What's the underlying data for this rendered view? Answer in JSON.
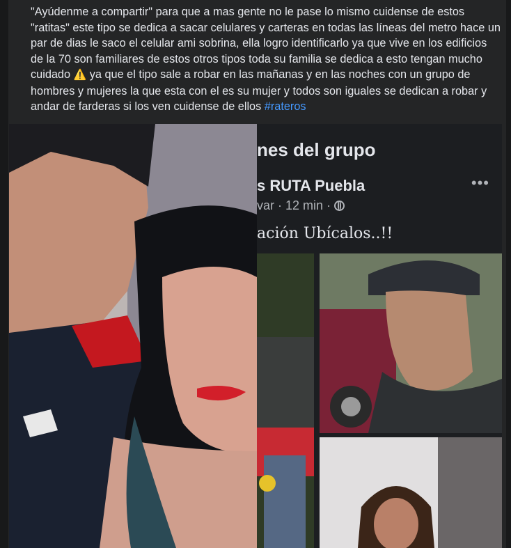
{
  "post": {
    "text_main": "\"Ayúdenme a compartir\" para que a mas gente no le pase lo mismo cuidense de estos \"ratitas\" este tipo se dedica a sacar celulares y carteras en todas las líneas del metro hace un par de dias le saco el celular ami sobrina, ella logro identificarlo ya que vive en los edificios de la 70 son familiares de estos otros tipos toda su familia se dedica a esto tengan mucho cuidado ",
    "warning_emoji": "⚠️",
    "text_after": " ya que el tipo sale a robar en las mañanas y en las noches con un grupo de hombres y mujeres la que esta con el es su mujer y todos son iguales se dedican a robar y andar de farderas si los ven cuidense de ellos ",
    "hashtag": "#rateros"
  },
  "embedded": {
    "section_title": "nes del grupo",
    "group_name": "s RUTA Puebla",
    "more": "•••",
    "author_fragment": "var",
    "time": "12 min",
    "caption": "ación Ubícalos..!!"
  },
  "icons": {
    "warning": "warning-icon",
    "globe": "globe-icon",
    "more": "more-options-icon",
    "play": "play-icon"
  },
  "colors": {
    "background": "#18191a",
    "card": "#242526",
    "text": "#e4e6eb",
    "hashtag": "#4599ff",
    "muted": "#b0b3b8"
  }
}
